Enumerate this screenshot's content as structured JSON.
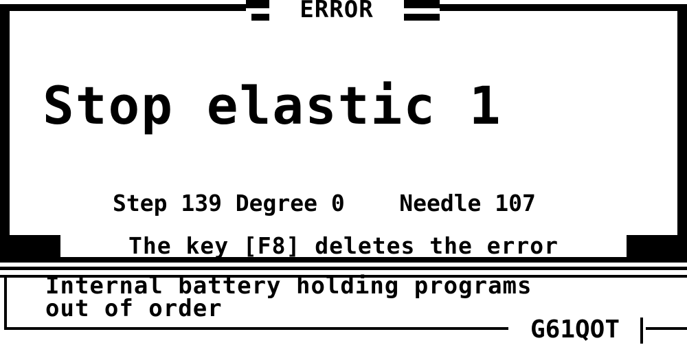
{
  "dialog": {
    "title": "ERROR",
    "message": "Stop elastic 1",
    "details": "Step 139 Degree 0    Needle 107",
    "hint": "The key [F8] deletes the error"
  },
  "status_panel": {
    "message": "Internal battery holding programs\nout of order",
    "code": "G61QOT"
  }
}
